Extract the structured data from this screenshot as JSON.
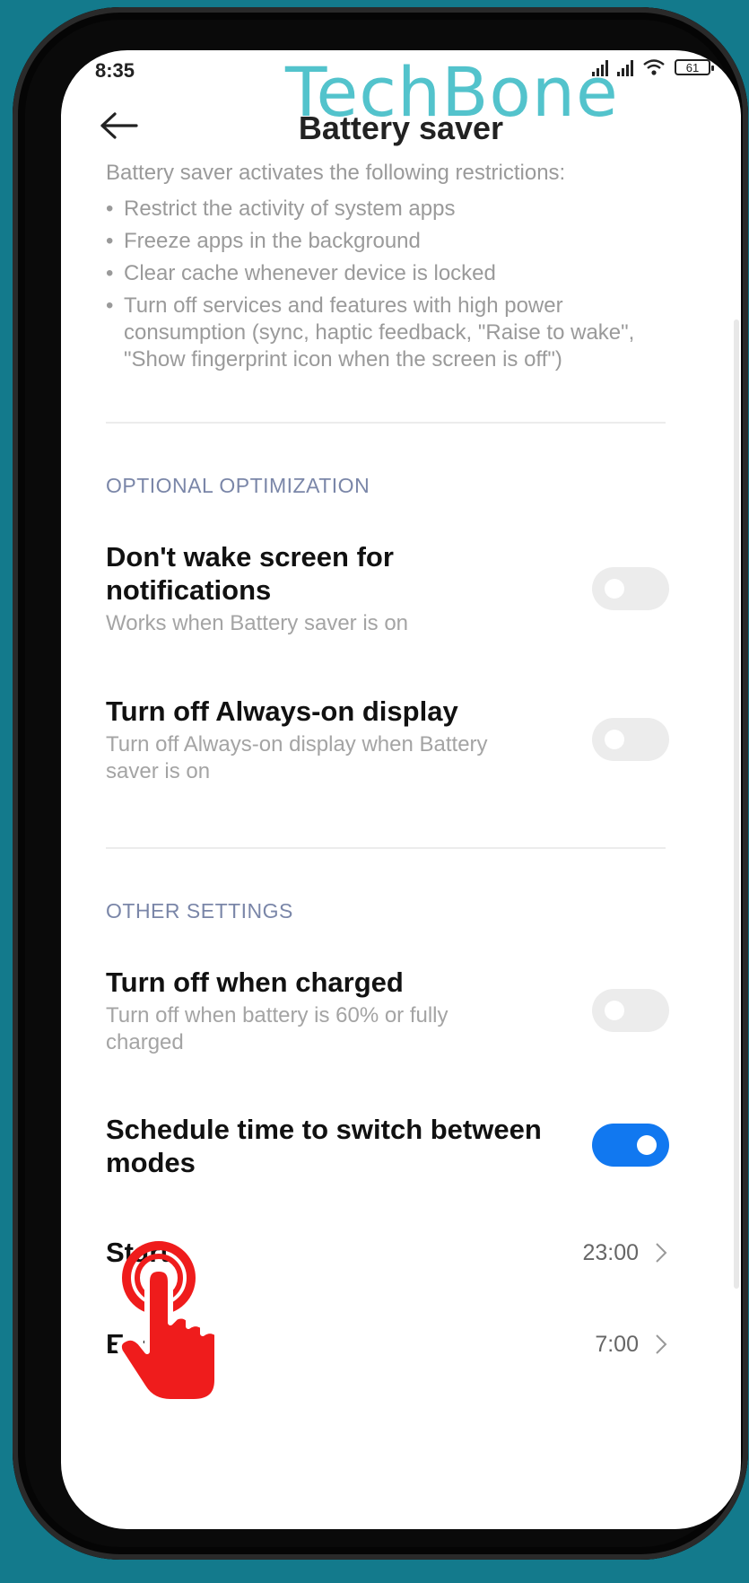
{
  "status_bar": {
    "time": "8:35",
    "battery": "61"
  },
  "watermark": "TechBone",
  "header": {
    "title": "Battery saver"
  },
  "intro": {
    "lead": "Battery saver activates the following restrictions:",
    "bullets": [
      "Restrict the activity of system apps",
      "Freeze apps in the background",
      "Clear cache whenever device is locked",
      "Turn off services and features with high power consumption (sync, haptic feedback, \"Raise to wake\", \"Show fingerprint icon when the screen is off\")"
    ]
  },
  "sections": {
    "optional": {
      "header": "OPTIONAL OPTIMIZATION",
      "items": [
        {
          "title": "Don't wake screen for notifications",
          "subtitle": "Works when Battery saver is on",
          "enabled": false
        },
        {
          "title": "Turn off Always-on display",
          "subtitle": "Turn off Always-on display when Battery saver is on",
          "enabled": false
        }
      ]
    },
    "other": {
      "header": "OTHER SETTINGS",
      "items": [
        {
          "title": "Turn off when charged",
          "subtitle": "Turn off when battery is 60% or fully charged",
          "enabled": false
        },
        {
          "title": "Schedule time to switch between modes",
          "enabled": true
        }
      ]
    }
  },
  "schedule": {
    "start": {
      "label": "Start",
      "value": "23:00"
    },
    "end": {
      "label": "End",
      "value": "7:00"
    }
  },
  "colors": {
    "accent": "#1178f0",
    "background": "#137a8c",
    "tap_indicator": "#ef1c1c"
  }
}
